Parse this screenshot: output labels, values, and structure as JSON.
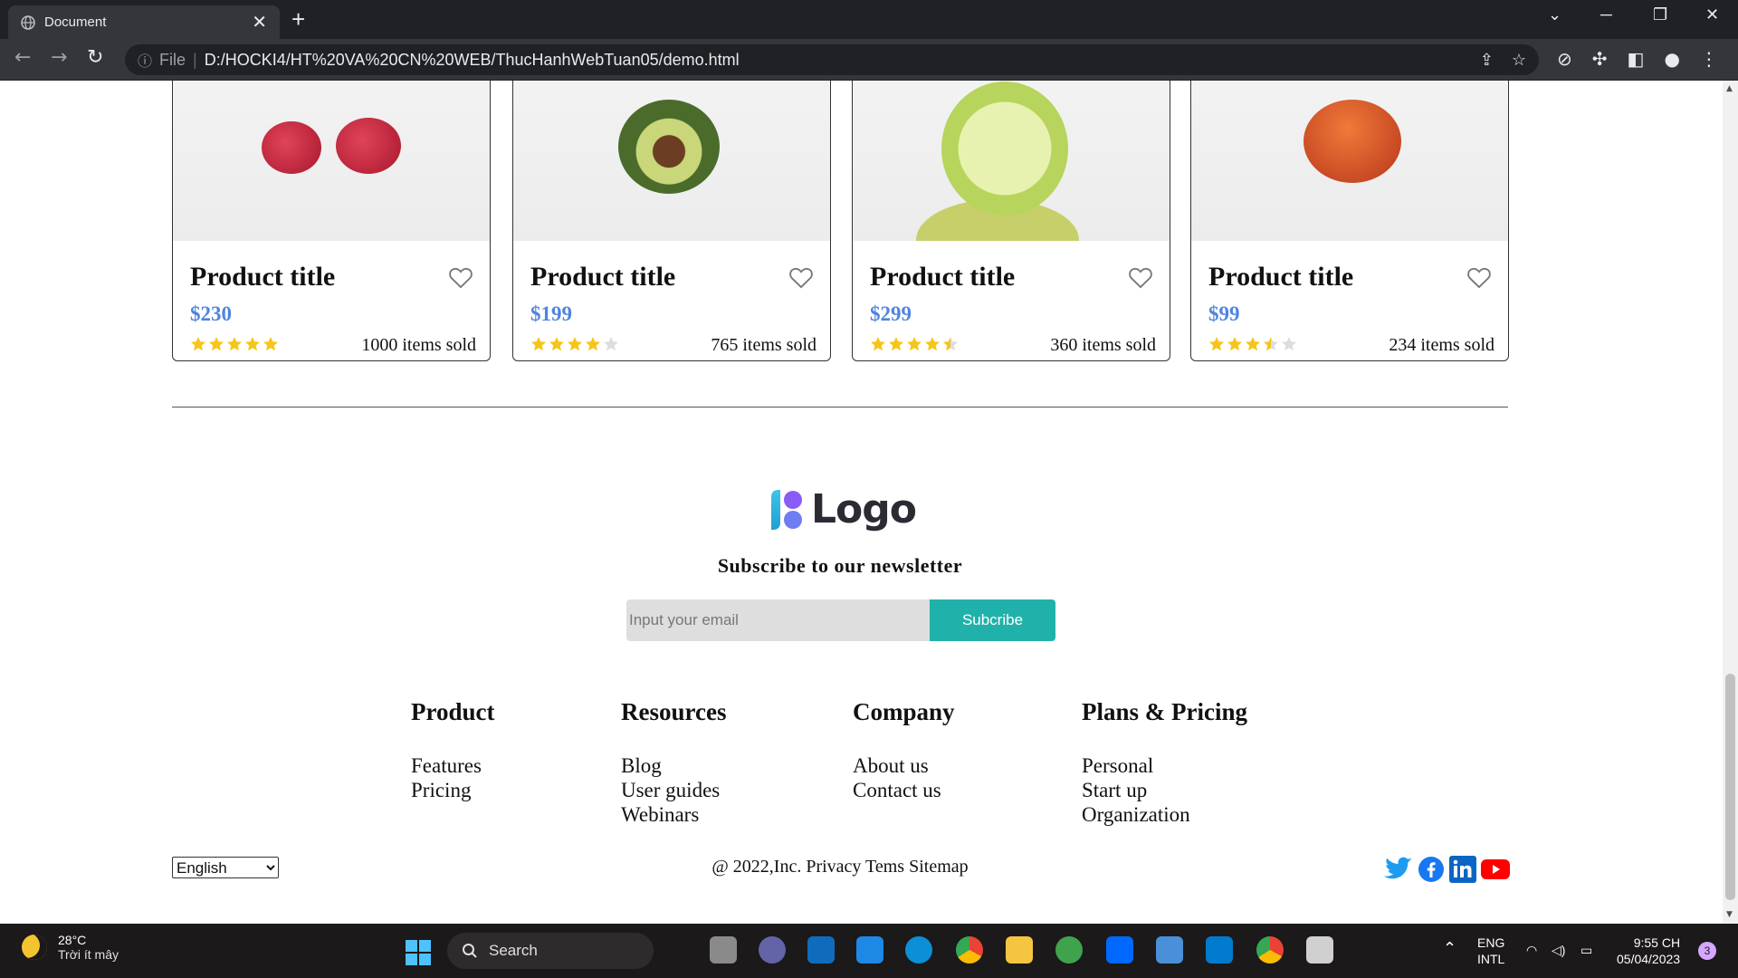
{
  "browser": {
    "tab_title": "Document",
    "tab_close": "✕",
    "new_tab": "+",
    "url_scheme": "File",
    "url": "D:/HOCKI4/HT%20VA%20CN%20WEB/ThucHanhWebTuan05/demo.html"
  },
  "products": [
    {
      "title": "Product title",
      "price": "$230",
      "sold": "1000 items sold",
      "rating": 5
    },
    {
      "title": "Product title",
      "price": "$199",
      "sold": "765 items sold",
      "rating": 4
    },
    {
      "title": "Product title",
      "price": "$299",
      "sold": "360 items sold",
      "rating": 4.5
    },
    {
      "title": "Product title",
      "price": "$99",
      "sold": "234 items sold",
      "rating": 3.5
    }
  ],
  "footer": {
    "logo_text": "Logo",
    "newsletter_title": "Subscribe to our newsletter",
    "email_placeholder": "Input your email",
    "subscribe_label": "Subcribe",
    "columns": [
      {
        "title": "Product",
        "links": [
          "Features",
          "Pricing"
        ]
      },
      {
        "title": "Resources",
        "links": [
          "Blog",
          "User guides",
          "Webinars"
        ]
      },
      {
        "title": "Company",
        "links": [
          "About us",
          "Contact us"
        ]
      },
      {
        "title": "Plans & Pricing",
        "links": [
          "Personal",
          "Start up",
          "Organization"
        ]
      }
    ],
    "language": "English",
    "copyright": "@ 2022,Inc. Privacy Tems Sitemap",
    "social_icons": [
      "twitter-icon",
      "facebook-icon",
      "linkedin-icon",
      "youtube-icon"
    ]
  },
  "taskbar": {
    "weather_temp": "28°C",
    "weather_desc": "Trời ít mây",
    "search_label": "Search",
    "lang_line1": "ENG",
    "lang_line2": "INTL",
    "time": "9:55 CH",
    "date": "05/04/2023",
    "notification_count": "3"
  },
  "colors": {
    "accent_price": "#4f84e0",
    "subscribe_bg": "#20b2aa",
    "star": "#f5c518",
    "star_empty": "#dddddd"
  }
}
